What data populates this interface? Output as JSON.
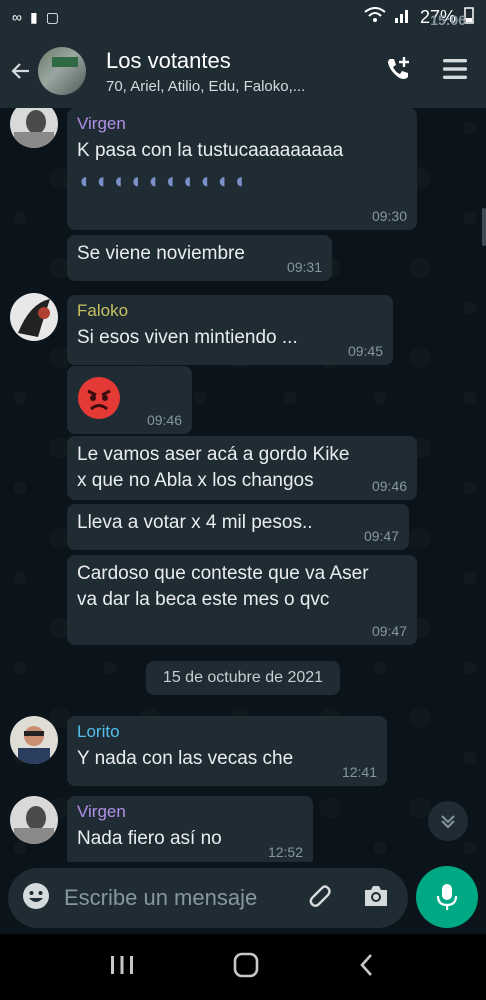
{
  "status_bar": {
    "time": "15:06",
    "battery": "27%"
  },
  "header": {
    "title": "Los votantes",
    "subtitle": "70, Ariel, Atilio, Edu, Faloko,..."
  },
  "messages": [
    {
      "sender": "Virgen",
      "sender_color": "#b190e6",
      "text": "K pasa con la tustucaaaaaaaaa",
      "emoji_count": 10,
      "time": "09:30"
    },
    {
      "text": "Se viene noviembre",
      "time": "09:31"
    },
    {
      "sender": "Faloko",
      "sender_color": "#c7c05f",
      "text": "Si esos viven mintiendo ...",
      "time": "09:45"
    },
    {
      "emoji": "angry-face",
      "time": "09:46"
    },
    {
      "text": "Le vamos aser acá a gordo Kike x que no Abla x los changos",
      "time": "09:46"
    },
    {
      "text": "Lleva a votar x 4 mil pesos..",
      "time": "09:47"
    },
    {
      "text": "Cardoso que conteste que va Aser va dar la beca este mes o qvc",
      "time": "09:47"
    },
    {
      "sender": "Lorito",
      "sender_color": "#53bdeb",
      "text": "Y nada con las vecas che",
      "time": "12:41"
    },
    {
      "sender": "Virgen",
      "sender_color": "#b190e6",
      "text": "Nada  fiero así no",
      "time": "12:52"
    }
  ],
  "date_divider": "15 de octubre de 2021",
  "composer": {
    "placeholder": "Escribe un mensaje"
  },
  "colors": {
    "bubble": "#1f2c34",
    "background": "#0b141a",
    "accent": "#00a884"
  },
  "icons": [
    "back-arrow-icon",
    "add-call-icon",
    "menu-icon",
    "emoji-icon",
    "attach-icon",
    "camera-icon",
    "mic-icon",
    "scroll-down-icon",
    "recents-icon",
    "home-icon",
    "nav-back-icon"
  ]
}
